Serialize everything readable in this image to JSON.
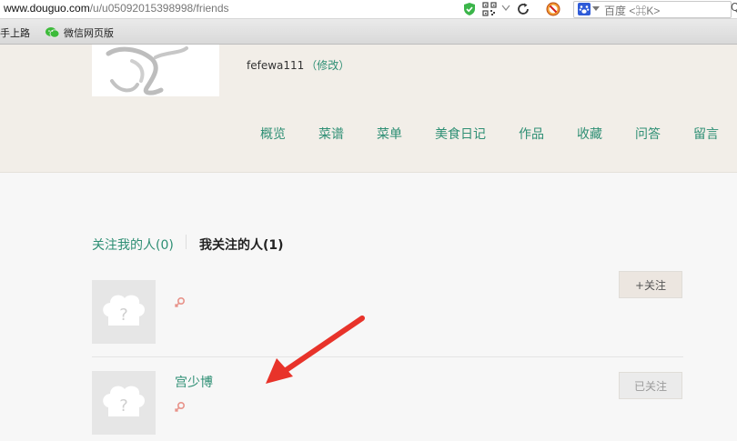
{
  "browser": {
    "url_host": "www.douguo.com",
    "url_path": "/u/u05092015398998/friends",
    "search_placeholder": "百度 <⌘K>",
    "search_glass_fragment": "Q",
    "bookmarks": [
      {
        "label": "手上路"
      },
      {
        "label": "微信网页版"
      }
    ]
  },
  "profile": {
    "username": "fefewa111",
    "edit_label": "（修改）"
  },
  "nav": {
    "items": [
      {
        "label": "概览"
      },
      {
        "label": "菜谱"
      },
      {
        "label": "菜单"
      },
      {
        "label": "美食日记"
      },
      {
        "label": "作品"
      },
      {
        "label": "收藏"
      },
      {
        "label": "问答"
      },
      {
        "label": "留言"
      }
    ]
  },
  "tabs": {
    "followers": "关注我的人(0)",
    "following": "我关注的人(1)"
  },
  "users": [
    {
      "name": "",
      "button_label": "+关注"
    },
    {
      "name": "宫少博",
      "button_label": "已关注"
    }
  ],
  "colors": {
    "accent": "#2e8f74",
    "header_bg": "#f2eee8",
    "annotation_arrow": "#e8332a"
  }
}
